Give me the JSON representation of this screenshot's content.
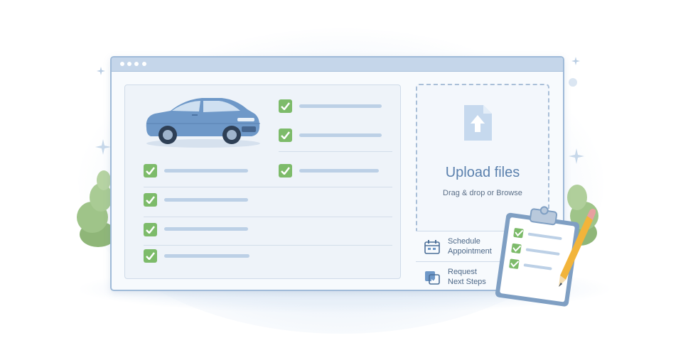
{
  "upload": {
    "title": "Upload files",
    "subtitle": "Drag & drop or Browse"
  },
  "actions": [
    {
      "line1": "Schedule",
      "line2": "Appointment",
      "icon": "calendar-icon"
    },
    {
      "line1": "Request",
      "line2": "Next Steps",
      "icon": "request-icon"
    }
  ],
  "colors": {
    "accent": "#5a80ad",
    "check": "#7dbb6a",
    "window_border": "#9fbad8",
    "titlebar": "#c5d6ea",
    "placeholder_line": "#bcd0e6"
  },
  "icons": [
    "car-illustration",
    "checkbox-checked-icon",
    "file-upload-icon",
    "calendar-icon",
    "request-icon",
    "clipboard-checklist-icon",
    "pencil-icon",
    "sparkle-icon",
    "bush-decoration"
  ]
}
